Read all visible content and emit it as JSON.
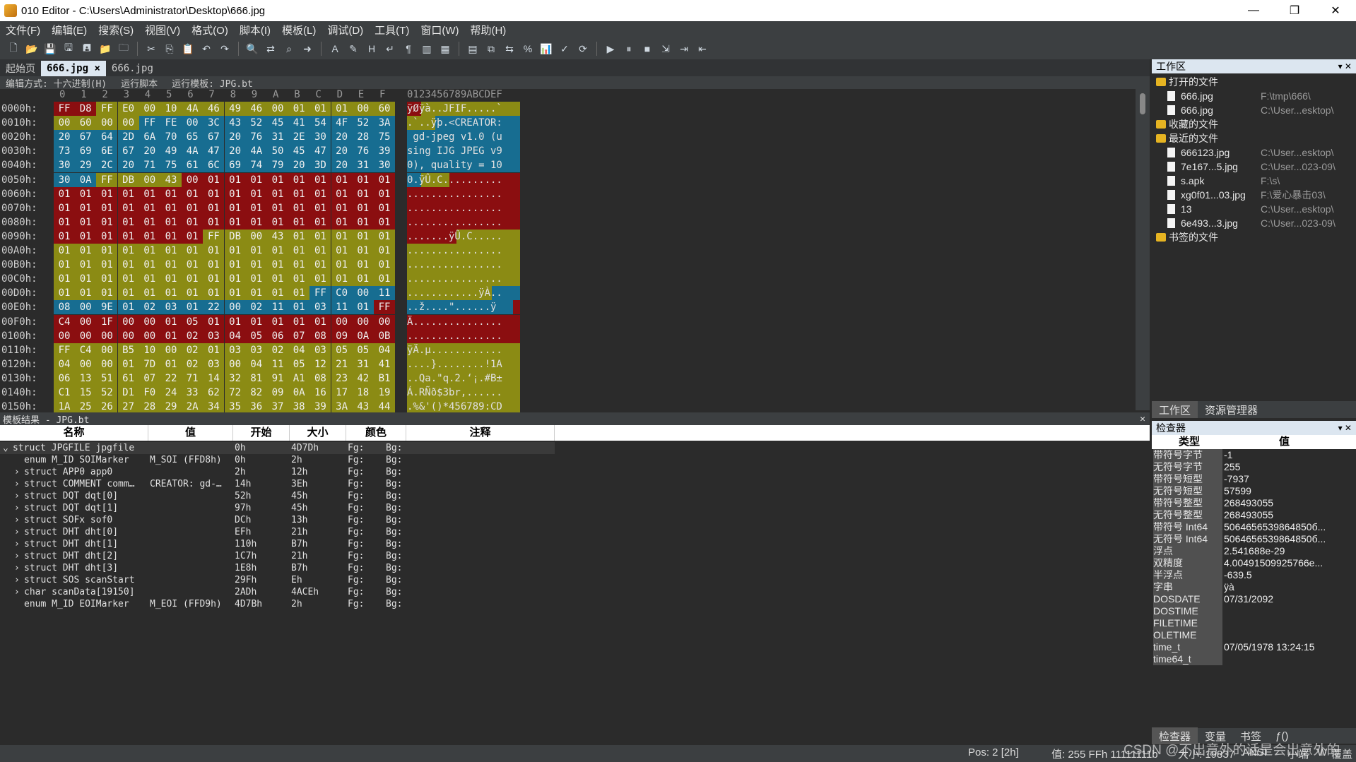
{
  "window": {
    "title": "010 Editor - C:\\Users\\Administrator\\Desktop\\666.jpg",
    "controls": [
      "—",
      "❐",
      "✕"
    ]
  },
  "menu": [
    "文件(F)",
    "编辑(E)",
    "搜索(S)",
    "视图(V)",
    "格式(O)",
    "脚本(I)",
    "模板(L)",
    "调试(D)",
    "工具(T)",
    "窗口(W)",
    "帮助(H)"
  ],
  "tabs": {
    "start": "起始页",
    "active": "666.jpg",
    "active_close": "×",
    "other": "666.jpg"
  },
  "hex_header": {
    "edit_mode": "编辑方式: 十六进制(H)",
    "run_script": "运行脚本",
    "run_template": "运行模板: JPG.bt"
  },
  "hex": {
    "columns": [
      "0",
      "1",
      "2",
      "3",
      "4",
      "5",
      "6",
      "7",
      "8",
      "9",
      "A",
      "B",
      "C",
      "D",
      "E",
      "F"
    ],
    "char_header": "0123456789ABCDEF",
    "rows": [
      {
        "addr": "0000h:",
        "bytes": [
          "FF",
          "D8",
          "FF",
          "E0",
          "00",
          "10",
          "4A",
          "46",
          "49",
          "46",
          "00",
          "01",
          "01",
          "01",
          "00",
          "60"
        ],
        "colors": "RRYYYYYYYYYYYYYY",
        "text": "ÿØÿà..JFIF.....`"
      },
      {
        "addr": "0010h:",
        "bytes": [
          "00",
          "60",
          "00",
          "00",
          "FF",
          "FE",
          "00",
          "3C",
          "43",
          "52",
          "45",
          "41",
          "54",
          "4F",
          "52",
          "3A"
        ],
        "colors": "YYYYBBBBBBBBBBBB",
        "text": ".`..ÿþ.<CREATOR:"
      },
      {
        "addr": "0020h:",
        "bytes": [
          "20",
          "67",
          "64",
          "2D",
          "6A",
          "70",
          "65",
          "67",
          "20",
          "76",
          "31",
          "2E",
          "30",
          "20",
          "28",
          "75"
        ],
        "colors": "BBBBBBBBBBBBBBBB",
        "text": " gd-jpeg v1.0 (u"
      },
      {
        "addr": "0030h:",
        "bytes": [
          "73",
          "69",
          "6E",
          "67",
          "20",
          "49",
          "4A",
          "47",
          "20",
          "4A",
          "50",
          "45",
          "47",
          "20",
          "76",
          "39"
        ],
        "colors": "BBBBBBBBBBBBBBBB",
        "text": "sing IJG JPEG v9"
      },
      {
        "addr": "0040h:",
        "bytes": [
          "30",
          "29",
          "2C",
          "20",
          "71",
          "75",
          "61",
          "6C",
          "69",
          "74",
          "79",
          "20",
          "3D",
          "20",
          "31",
          "30"
        ],
        "colors": "BBBBBBBBBBBBBBBB",
        "text": "0), quality = 10"
      },
      {
        "addr": "0050h:",
        "bytes": [
          "30",
          "0A",
          "FF",
          "DB",
          "00",
          "43",
          "00",
          "01",
          "01",
          "01",
          "01",
          "01",
          "01",
          "01",
          "01",
          "01"
        ],
        "colors": "BBYYYYRRRRRRRRRR",
        "text": "0.ÿÛ.C.........."
      },
      {
        "addr": "0060h:",
        "bytes": [
          "01",
          "01",
          "01",
          "01",
          "01",
          "01",
          "01",
          "01",
          "01",
          "01",
          "01",
          "01",
          "01",
          "01",
          "01",
          "01"
        ],
        "colors": "RRRRRRRRRRRRRRRR",
        "text": "................"
      },
      {
        "addr": "0070h:",
        "bytes": [
          "01",
          "01",
          "01",
          "01",
          "01",
          "01",
          "01",
          "01",
          "01",
          "01",
          "01",
          "01",
          "01",
          "01",
          "01",
          "01"
        ],
        "colors": "RRRRRRRRRRRRRRRR",
        "text": "................"
      },
      {
        "addr": "0080h:",
        "bytes": [
          "01",
          "01",
          "01",
          "01",
          "01",
          "01",
          "01",
          "01",
          "01",
          "01",
          "01",
          "01",
          "01",
          "01",
          "01",
          "01"
        ],
        "colors": "RRRRRRRRRRRRRRRR",
        "text": "................"
      },
      {
        "addr": "0090h:",
        "bytes": [
          "01",
          "01",
          "01",
          "01",
          "01",
          "01",
          "01",
          "FF",
          "DB",
          "00",
          "43",
          "01",
          "01",
          "01",
          "01",
          "01"
        ],
        "colors": "RRRRRRRYYYYYYYYY",
        "text": ".......ÿÛ.C....."
      },
      {
        "addr": "00A0h:",
        "bytes": [
          "01",
          "01",
          "01",
          "01",
          "01",
          "01",
          "01",
          "01",
          "01",
          "01",
          "01",
          "01",
          "01",
          "01",
          "01",
          "01"
        ],
        "colors": "YYYYYYYYYYYYYYYY",
        "text": "................"
      },
      {
        "addr": "00B0h:",
        "bytes": [
          "01",
          "01",
          "01",
          "01",
          "01",
          "01",
          "01",
          "01",
          "01",
          "01",
          "01",
          "01",
          "01",
          "01",
          "01",
          "01"
        ],
        "colors": "YYYYYYYYYYYYYYYY",
        "text": "................"
      },
      {
        "addr": "00C0h:",
        "bytes": [
          "01",
          "01",
          "01",
          "01",
          "01",
          "01",
          "01",
          "01",
          "01",
          "01",
          "01",
          "01",
          "01",
          "01",
          "01",
          "01"
        ],
        "colors": "YYYYYYYYYYYYYYYY",
        "text": "................"
      },
      {
        "addr": "00D0h:",
        "bytes": [
          "01",
          "01",
          "01",
          "01",
          "01",
          "01",
          "01",
          "01",
          "01",
          "01",
          "01",
          "01",
          "FF",
          "C0",
          "00",
          "11"
        ],
        "colors": "YYYYYYYYYYYYBBBB",
        "text": "............ÿÀ.."
      },
      {
        "addr": "00E0h:",
        "bytes": [
          "08",
          "00",
          "9E",
          "01",
          "02",
          "03",
          "01",
          "22",
          "00",
          "02",
          "11",
          "01",
          "03",
          "11",
          "01",
          "FF"
        ],
        "colors": "BBBBBBBBBBBBBBBR",
        "text": "..ž....\"......ÿ"
      },
      {
        "addr": "00F0h:",
        "bytes": [
          "C4",
          "00",
          "1F",
          "00",
          "00",
          "01",
          "05",
          "01",
          "01",
          "01",
          "01",
          "01",
          "01",
          "00",
          "00",
          "00"
        ],
        "colors": "RRRRRRRRRRRRRRRR",
        "text": "Ä..............."
      },
      {
        "addr": "0100h:",
        "bytes": [
          "00",
          "00",
          "00",
          "00",
          "00",
          "01",
          "02",
          "03",
          "04",
          "05",
          "06",
          "07",
          "08",
          "09",
          "0A",
          "0B"
        ],
        "colors": "RRRRRRRRRRRRRRRR",
        "text": "................"
      },
      {
        "addr": "0110h:",
        "bytes": [
          "FF",
          "C4",
          "00",
          "B5",
          "10",
          "00",
          "02",
          "01",
          "03",
          "03",
          "02",
          "04",
          "03",
          "05",
          "05",
          "04"
        ],
        "colors": "YYYYYYYYYYYYYYYY",
        "text": "ÿÄ.µ............"
      },
      {
        "addr": "0120h:",
        "bytes": [
          "04",
          "00",
          "00",
          "01",
          "7D",
          "01",
          "02",
          "03",
          "00",
          "04",
          "11",
          "05",
          "12",
          "21",
          "31",
          "41"
        ],
        "colors": "YYYYYYYYYYYYYYYY",
        "text": "....}........!1A"
      },
      {
        "addr": "0130h:",
        "bytes": [
          "06",
          "13",
          "51",
          "61",
          "07",
          "22",
          "71",
          "14",
          "32",
          "81",
          "91",
          "A1",
          "08",
          "23",
          "42",
          "B1"
        ],
        "colors": "YYYYYYYYYYYYYYYY",
        "text": "..Qa.\"q.2.‘¡.#B±"
      },
      {
        "addr": "0140h:",
        "bytes": [
          "C1",
          "15",
          "52",
          "D1",
          "F0",
          "24",
          "33",
          "62",
          "72",
          "82",
          "09",
          "0A",
          "16",
          "17",
          "18",
          "19"
        ],
        "colors": "YYYYYYYYYYYYYYYY",
        "text": "Á.RÑð$3br,......"
      },
      {
        "addr": "0150h:",
        "bytes": [
          "1A",
          "25",
          "26",
          "27",
          "28",
          "29",
          "2A",
          "34",
          "35",
          "36",
          "37",
          "38",
          "39",
          "3A",
          "43",
          "44"
        ],
        "colors": "YYYYYYYYYYYYYYYY",
        "text": ".%&'()*456789:CD"
      }
    ]
  },
  "workspace": {
    "title": "工作区",
    "btns": "▾ ✕",
    "open_files_label": "打开的文件",
    "open_files": [
      {
        "name": "666.jpg",
        "path": "F:\\tmp\\666\\"
      },
      {
        "name": "666.jpg",
        "path": "C:\\User...esktop\\"
      }
    ],
    "favorites_label": "收藏的文件",
    "recent_label": "最近的文件",
    "recent_files": [
      {
        "name": "666123.jpg",
        "path": "C:\\User...esktop\\"
      },
      {
        "name": "7e167...5.jpg",
        "path": "C:\\User...023-09\\"
      },
      {
        "name": "s.apk",
        "path": "F:\\s\\"
      },
      {
        "name": "xg0f01...03.jpg",
        "path": "F:\\爱心暴击03\\"
      },
      {
        "name": "13",
        "path": "C:\\User...esktop\\"
      },
      {
        "name": "6e493...3.jpg",
        "path": "C:\\User...023-09\\"
      }
    ],
    "bookmarked_label": "书签的文件",
    "tab_workspace": "工作区",
    "tab_explorer": "资源管理器"
  },
  "template": {
    "title": "模板结果 - JPG.bt",
    "close": "✕",
    "columns": [
      "名称",
      "值",
      "开始",
      "大小",
      "颜色",
      "注释"
    ],
    "rows": [
      {
        "name": "struct JPGFILE jpgfile",
        "value": "",
        "start": "0h",
        "size": "4D7Dh",
        "fg": "Fg:",
        "bg": "Bg:",
        "expand": "⌄",
        "indent": 0
      },
      {
        "name": "enum M_ID SOIMarker",
        "value": "M_SOI (FFD8h)",
        "start": "0h",
        "size": "2h",
        "fg": "Fg:",
        "bg": "Bg:",
        "expand": "",
        "indent": 1
      },
      {
        "name": "struct APP0 app0",
        "value": "",
        "start": "2h",
        "size": "12h",
        "fg": "Fg:",
        "bg": "Bg:",
        "expand": "›",
        "indent": 1
      },
      {
        "name": "struct COMMENT comm…",
        "value": "CREATOR: gd-…",
        "start": "14h",
        "size": "3Eh",
        "fg": "Fg:",
        "bg": "Bg:",
        "expand": "›",
        "indent": 1
      },
      {
        "name": "struct DQT dqt[0]",
        "value": "",
        "start": "52h",
        "size": "45h",
        "fg": "Fg:",
        "bg": "Bg:",
        "expand": "›",
        "indent": 1
      },
      {
        "name": "struct DQT dqt[1]",
        "value": "",
        "start": "97h",
        "size": "45h",
        "fg": "Fg:",
        "bg": "Bg:",
        "expand": "›",
        "indent": 1
      },
      {
        "name": "struct SOFx sof0",
        "value": "",
        "start": "DCh",
        "size": "13h",
        "fg": "Fg:",
        "bg": "Bg:",
        "expand": "›",
        "indent": 1
      },
      {
        "name": "struct DHT dht[0]",
        "value": "",
        "start": "EFh",
        "size": "21h",
        "fg": "Fg:",
        "bg": "Bg:",
        "expand": "›",
        "indent": 1
      },
      {
        "name": "struct DHT dht[1]",
        "value": "",
        "start": "110h",
        "size": "B7h",
        "fg": "Fg:",
        "bg": "Bg:",
        "expand": "›",
        "indent": 1
      },
      {
        "name": "struct DHT dht[2]",
        "value": "",
        "start": "1C7h",
        "size": "21h",
        "fg": "Fg:",
        "bg": "Bg:",
        "expand": "›",
        "indent": 1
      },
      {
        "name": "struct DHT dht[3]",
        "value": "",
        "start": "1E8h",
        "size": "B7h",
        "fg": "Fg:",
        "bg": "Bg:",
        "expand": "›",
        "indent": 1
      },
      {
        "name": "struct SOS scanStart",
        "value": "",
        "start": "29Fh",
        "size": "Eh",
        "fg": "Fg:",
        "bg": "Bg:",
        "expand": "›",
        "indent": 1
      },
      {
        "name": "char scanData[19150]",
        "value": "",
        "start": "2ADh",
        "size": "4ACEh",
        "fg": "Fg:",
        "bg": "Bg:",
        "expand": "›",
        "indent": 1
      },
      {
        "name": "enum M_ID EOIMarker",
        "value": "M_EOI (FFD9h)",
        "start": "4D7Bh",
        "size": "2h",
        "fg": "Fg:",
        "bg": "Bg:",
        "expand": "",
        "indent": 1
      }
    ]
  },
  "inspector": {
    "title": "检查器",
    "btns": "▾ ✕",
    "col_type": "类型",
    "col_value": "值",
    "rows": [
      {
        "k": "带符号字节",
        "v": "-1"
      },
      {
        "k": "无符号字节",
        "v": "255"
      },
      {
        "k": "带符号短型",
        "v": "-7937"
      },
      {
        "k": "无符号短型",
        "v": "57599"
      },
      {
        "k": "带符号整型",
        "v": "268493055"
      },
      {
        "k": "无符号整型",
        "v": "268493055"
      },
      {
        "k": "带符号 Int64",
        "v": "5064656539864850б..."
      },
      {
        "k": "无符号 Int64",
        "v": "5064656539864850б..."
      },
      {
        "k": "浮点",
        "v": "2.541688e-29"
      },
      {
        "k": "双精度",
        "v": "4.00491509925766e..."
      },
      {
        "k": "半浮点",
        "v": "-639.5"
      },
      {
        "k": "字串",
        "v": "ÿà"
      },
      {
        "k": "DOSDATE",
        "v": "07/31/2092"
      },
      {
        "k": "DOSTIME",
        "v": ""
      },
      {
        "k": "FILETIME",
        "v": ""
      },
      {
        "k": "OLETIME",
        "v": ""
      },
      {
        "k": "time_t",
        "v": "07/05/1978 13:24:15"
      },
      {
        "k": "time64_t",
        "v": ""
      }
    ],
    "tab_inspector": "检查器",
    "tab_vars": "变量",
    "tab_bookmarks": "书签",
    "tab_fn": "ƒ()"
  },
  "status": {
    "pos": "Pos: 2 [2h]",
    "value": "值: 255 FFh 11111111b",
    "size": "大小: 19837",
    "enc": "ANSI",
    "mode1": "小端",
    "mode2": "W",
    "mode3": "覆盖"
  },
  "watermark": "CSDN @不出意外的话是会出意外的",
  "colors": {
    "red": "#8b0e10",
    "yellow": "#8b8b14",
    "blue": "#176d91"
  }
}
